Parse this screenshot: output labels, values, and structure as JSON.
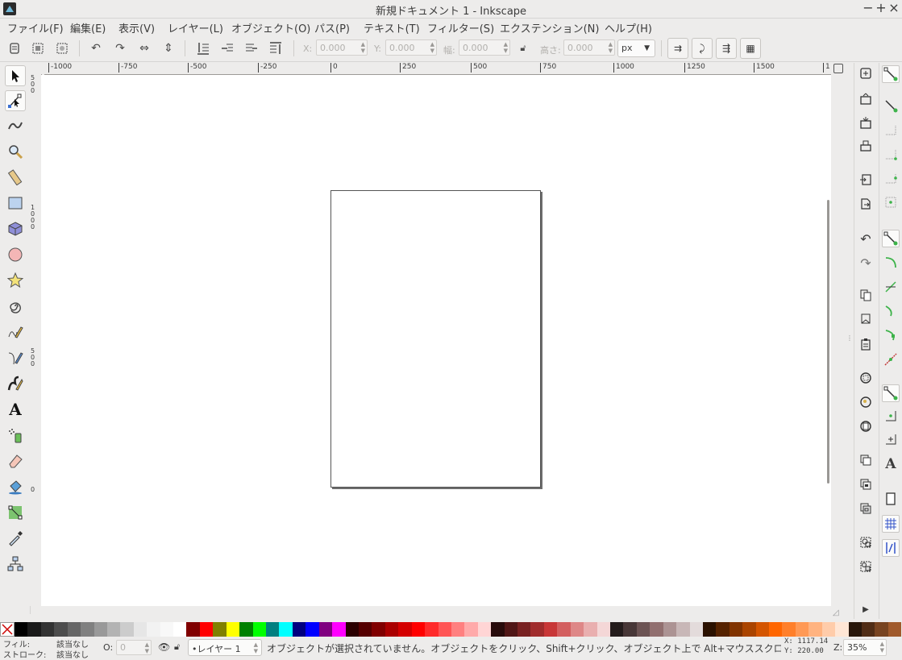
{
  "window": {
    "title": "新規ドキュメント 1 - Inkscape",
    "minimize": "−",
    "maximize": "+",
    "close": "×"
  },
  "menu": [
    "ファイル(F)",
    "編集(E)",
    "表示(V)",
    "レイヤー(L)",
    "オブジェクト(O)",
    "パス(P)",
    "テキスト(T)",
    "フィルター(S)",
    "エクステンション(N)",
    "ヘルプ(H)"
  ],
  "toolbar": {
    "x_label": "X:",
    "x_value": "0.000",
    "y_label": "Y:",
    "y_value": "0.000",
    "w_label": "幅:",
    "w_value": "0.000",
    "h_label": "高さ:",
    "h_value": "0.000",
    "unit": "px"
  },
  "ruler": {
    "h_labels": [
      "-1000",
      "-750",
      "-500",
      "-250",
      "0",
      "250",
      "500",
      "750",
      "1000",
      "1250",
      "1500",
      "1"
    ],
    "v_labels": [
      "500",
      "1000",
      "500",
      "0"
    ]
  },
  "tools": [
    "selector",
    "node",
    "tweak",
    "zoom",
    "measure",
    "rect",
    "3dbox",
    "ellipse",
    "star",
    "spiral",
    "pencil",
    "pen",
    "calligraphy",
    "text",
    "spray",
    "eraser",
    "paintbucket",
    "gradient",
    "dropper",
    "connector"
  ],
  "palette": {
    "colors": [
      "#000000",
      "#1a1a1a",
      "#333333",
      "#4d4d4d",
      "#666666",
      "#808080",
      "#999999",
      "#b3b3b3",
      "#cccccc",
      "#e6e6e6",
      "#f2f2f2",
      "#f8f8f8",
      "#ffffff",
      "#800000",
      "#ff0000",
      "#808000",
      "#ffff00",
      "#008000",
      "#00ff00",
      "#008080",
      "#00ffff",
      "#000080",
      "#0000ff",
      "#800080",
      "#ff00ff",
      "#2b0000",
      "#550000",
      "#800000",
      "#aa0000",
      "#d40000",
      "#ff0000",
      "#ff2a2a",
      "#ff5555",
      "#ff8080",
      "#ffaaaa",
      "#ffd5d5",
      "#280b0b",
      "#501616",
      "#782121",
      "#a02c2c",
      "#c83737",
      "#d35f5f",
      "#de8787",
      "#e9afaf",
      "#f4d7d7",
      "#241c1c",
      "#483737",
      "#6c5353",
      "#916f6f",
      "#ac9393",
      "#c8b7b7",
      "#e3dbdb",
      "#2b1100",
      "#552200",
      "#803300",
      "#aa4400",
      "#d45500",
      "#ff6600",
      "#ff7f2a",
      "#ff9955",
      "#ffb380",
      "#ffccaa",
      "#ffe6d5",
      "#28170b",
      "#502d16",
      "#784421",
      "#a05a2c"
    ]
  },
  "status": {
    "fill_label": "フィル:",
    "fill_value": "該当なし",
    "stroke_label": "ストローク:",
    "stroke_value": "該当なし",
    "opacity_label": "O:",
    "opacity_value": "0",
    "layer": "•レイヤー 1",
    "message": "オブジェクトが選択されていません。オブジェクトをクリック、Shift+クリック、オブジェクト上で Alt+マウススクロー",
    "x_coord": "X: 1117.14",
    "y_coord": "Y:  220.00",
    "zoom_label": "Z:",
    "zoom_value": "35%"
  }
}
